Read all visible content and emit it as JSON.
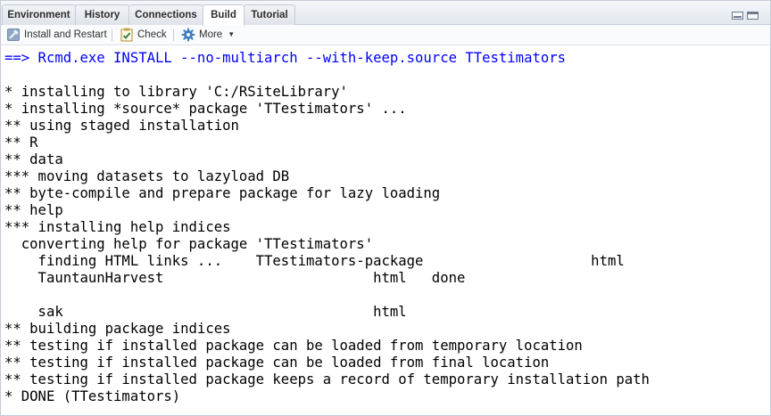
{
  "tabs": [
    {
      "label": "Environment",
      "active": false
    },
    {
      "label": "History",
      "active": false
    },
    {
      "label": "Connections",
      "active": false
    },
    {
      "label": "Build",
      "active": true
    },
    {
      "label": "Tutorial",
      "active": false
    }
  ],
  "toolbar": {
    "install_label": "Install and Restart",
    "check_label": "Check",
    "more_label": "More"
  },
  "console": {
    "command": "==> Rcmd.exe INSTALL --no-multiarch --with-keep.source TTestimators",
    "lines": [
      "* installing to library 'C:/RSiteLibrary'",
      "* installing *source* package 'TTestimators' ...",
      "** using staged installation",
      "** R",
      "** data",
      "*** moving datasets to lazyload DB",
      "** byte-compile and prepare package for lazy loading",
      "** help",
      "*** installing help indices",
      "  converting help for package 'TTestimators'",
      "    finding HTML links ...    TTestimators-package                    html",
      "    TauntaunHarvest                         html   done",
      "",
      "    sak                                     html",
      "** building package indices",
      "** testing if installed package can be loaded from temporary location",
      "** testing if installed package can be loaded from final location",
      "** testing if installed package keeps a record of temporary installation path",
      "* DONE (TTestimators)"
    ]
  },
  "colors": {
    "command_text": "#0000ff",
    "output_text": "#000000",
    "tab_border": "#c4ccd6"
  }
}
